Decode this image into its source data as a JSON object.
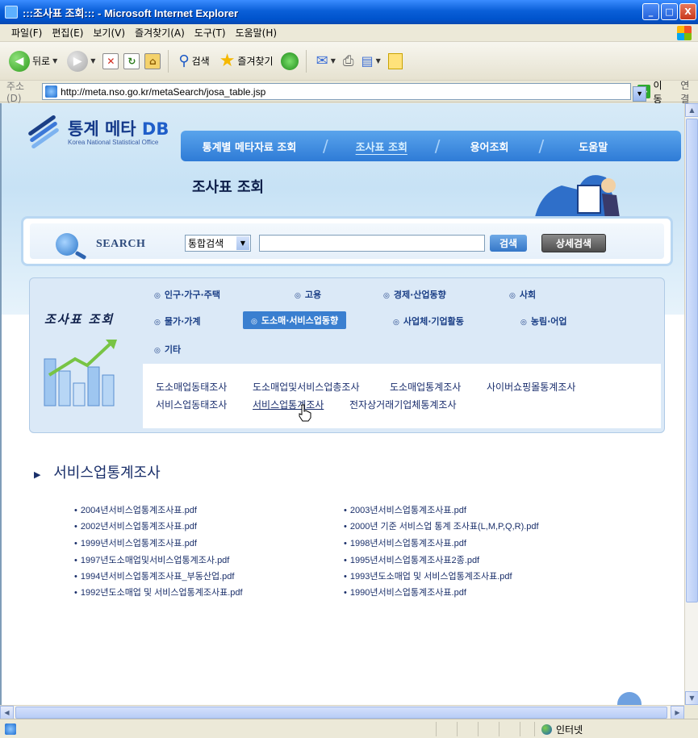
{
  "window": {
    "title": ":::조사표 조회::: - Microsoft Internet Explorer",
    "buttons": [
      "_",
      "□",
      "X"
    ]
  },
  "menu": [
    "파일(F)",
    "편집(E)",
    "보기(V)",
    "즐겨찾기(A)",
    "도구(T)",
    "도움말(H)"
  ],
  "toolbar": {
    "back_label": "뒤로",
    "search_label": "검색",
    "favorites_label": "즐겨찾기"
  },
  "address": {
    "label": "주소(D)",
    "url": "http://meta.nso.go.kr/metaSearch/josa_table.jsp",
    "go_label": "이동",
    "links_label": "연결"
  },
  "site": {
    "logo_title": "통계 메타",
    "logo_db": "DB",
    "logo_sub": "Korea National Statistical Office",
    "nav": [
      {
        "label": "통계별 메타자료 조회",
        "active": false
      },
      {
        "label": "조사표 조회",
        "active": true
      },
      {
        "label": "용어조회",
        "active": false
      },
      {
        "label": "도움말",
        "active": false
      }
    ],
    "page_title": "조사표 조회"
  },
  "search": {
    "label": "SEARCH",
    "select_value": "통합검색",
    "input_value": "",
    "search_button": "검색",
    "advanced_button": "상세검색"
  },
  "categories": {
    "side_title": "조사표 조회",
    "items": [
      {
        "label": "인구·가구·주택",
        "active": false
      },
      {
        "label": "고용",
        "active": false
      },
      {
        "label": "경제·산업동향",
        "active": false
      },
      {
        "label": "사회",
        "active": false
      },
      {
        "label": "물가·가계",
        "active": false
      },
      {
        "label": "도소매·서비스업동향",
        "active": true
      },
      {
        "label": "사업체·기업활동",
        "active": false
      },
      {
        "label": "농림·어업",
        "active": false
      },
      {
        "label": "기타",
        "active": false
      }
    ],
    "sub_items": [
      "도소매업동태조사",
      "도소매업및서비스업총조사",
      "도소매업통계조사",
      "사이버쇼핑몰통계조사",
      "서비스업동태조사",
      "서비스업통계조사",
      "전자상거래기업체통계조사"
    ]
  },
  "section": {
    "title": "서비스업통계조사",
    "files": [
      "2004년서비스업통계조사표.pdf",
      "2003년서비스업통계조사표.pdf",
      "2002년서비스업통계조사표.pdf",
      "2000년 기준 서비스업 통계 조사표(L,M,P,Q,R).pdf",
      "1999년서비스업통계조사표.pdf",
      "1998년서비스업통계조사표.pdf",
      "1997년도소매업및서비스업통계조사.pdf",
      "1995년서비스업통계조사표2종.pdf",
      "1994년서비스업통계조사표_부동산업.pdf",
      "1993년도소매업 및 서비스업통계조사표.pdf",
      "1992년도소매업 및 서비스업통계조사표.pdf",
      "1990년서비스업통계조사표.pdf"
    ]
  },
  "status": {
    "zone": "인터넷"
  },
  "colors": {
    "nav_blue": "#2e7bd6",
    "active_category": "#3a7fd0",
    "link_navy": "#1a2f6a"
  }
}
